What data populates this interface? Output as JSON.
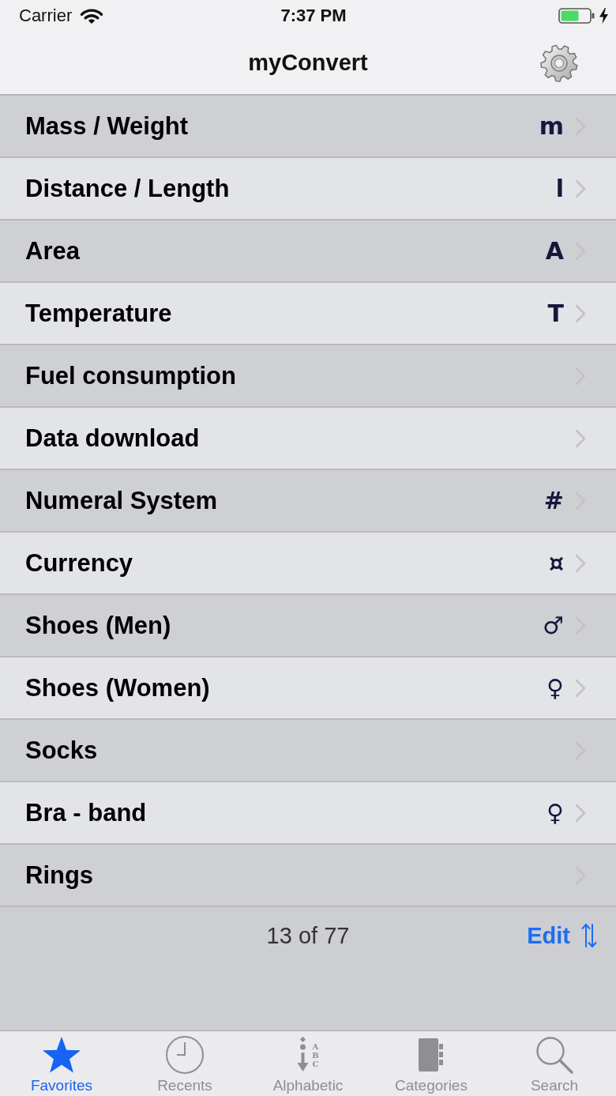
{
  "status_bar": {
    "carrier": "Carrier",
    "time": "7:37 PM"
  },
  "nav_bar": {
    "title": "myConvert"
  },
  "categories": [
    {
      "label": "Mass / Weight",
      "symbol": "m"
    },
    {
      "label": "Distance / Length",
      "symbol": "l"
    },
    {
      "label": "Area",
      "symbol": "A"
    },
    {
      "label": "Temperature",
      "symbol": "T"
    },
    {
      "label": "Fuel consumption"
    },
    {
      "label": "Data download"
    },
    {
      "label": "Numeral System",
      "symbol": "#"
    },
    {
      "label": "Currency",
      "symbol": "¤"
    },
    {
      "label": "Shoes (Men)",
      "symbol": "♂"
    },
    {
      "label": "Shoes (Women)",
      "symbol": "♀"
    },
    {
      "label": "Socks"
    },
    {
      "label": "Bra - band",
      "symbol": "♀"
    },
    {
      "label": "Rings"
    }
  ],
  "footer": {
    "count": "13 of 77",
    "edit_label": "Edit"
  },
  "tab_bar": [
    {
      "label": "Favorites",
      "selected": true
    },
    {
      "label": "Recents",
      "selected": false
    },
    {
      "label": "Alphabetic",
      "selected": false,
      "icon_letters": "ABC"
    },
    {
      "label": "Categories",
      "selected": false
    },
    {
      "label": "Search",
      "selected": false
    }
  ]
}
